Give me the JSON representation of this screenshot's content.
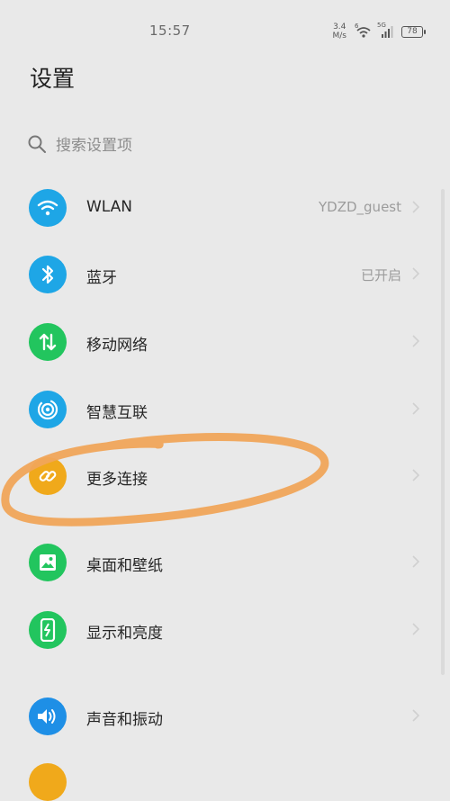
{
  "status": {
    "time": "15:57",
    "net_speed_value": "3.4",
    "net_speed_unit": "M/s",
    "wifi_badge": "6",
    "cell_badge": "5G",
    "battery": "78"
  },
  "header": {
    "title": "设置"
  },
  "search": {
    "placeholder": "搜索设置项"
  },
  "settings": {
    "items": [
      {
        "label": "WLAN",
        "value": "YDZD_guest",
        "icon": "wifi-icon",
        "color": "#1ea6e6"
      },
      {
        "label": "蓝牙",
        "value": "已开启",
        "icon": "bluetooth-icon",
        "color": "#1ea6e6"
      },
      {
        "label": "移动网络",
        "value": "",
        "icon": "mobile-data-icon",
        "color": "#22c55e"
      },
      {
        "label": "智慧互联",
        "value": "",
        "icon": "smart-connect-icon",
        "color": "#1ea6e6"
      },
      {
        "label": "更多连接",
        "value": "",
        "icon": "link-icon",
        "color": "#f0a91b"
      },
      {
        "label": "桌面和壁纸",
        "value": "",
        "icon": "wallpaper-icon",
        "color": "#22c55e"
      },
      {
        "label": "显示和亮度",
        "value": "",
        "icon": "display-brightness-icon",
        "color": "#22c55e"
      },
      {
        "label": "声音和振动",
        "value": "",
        "icon": "sound-icon",
        "color": "#1e8fe6"
      }
    ]
  },
  "annotation": {
    "color": "#f0a55a"
  }
}
